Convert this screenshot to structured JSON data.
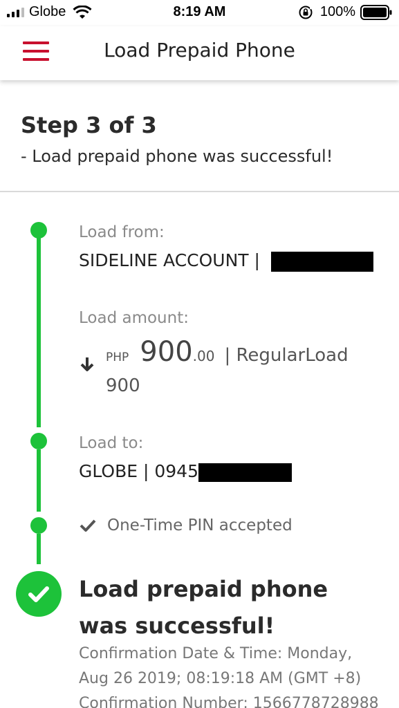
{
  "status_bar": {
    "carrier": "Globe",
    "time": "8:19 AM",
    "battery": "100%"
  },
  "header": {
    "title": "Load Prepaid Phone"
  },
  "step": {
    "title": "Step 3 of 3",
    "subtitle": "- Load prepaid phone was successful!"
  },
  "load_from": {
    "label": "Load from:",
    "value": "SIDELINE ACCOUNT |"
  },
  "load_amount": {
    "label": "Load amount:",
    "currency": "PHP",
    "whole": "900",
    "cents": ".00",
    "product_line1": "| RegularLoad",
    "product_line2": "900"
  },
  "load_to": {
    "label": "Load to:",
    "value": "GLOBE | 0945"
  },
  "otp": {
    "text": "One-Time PIN accepted"
  },
  "result": {
    "title": "Load prepaid phone was successful!",
    "confirmation_line1": "Confirmation Date & Time: Monday,",
    "confirmation_line2": "Aug 26 2019; 08:19:18 AM (GMT +8)",
    "confirmation_line3": "Confirmation Number: 1566778728988"
  },
  "colors": {
    "accent_green": "#1dc23a",
    "menu_red": "#c8102e"
  }
}
